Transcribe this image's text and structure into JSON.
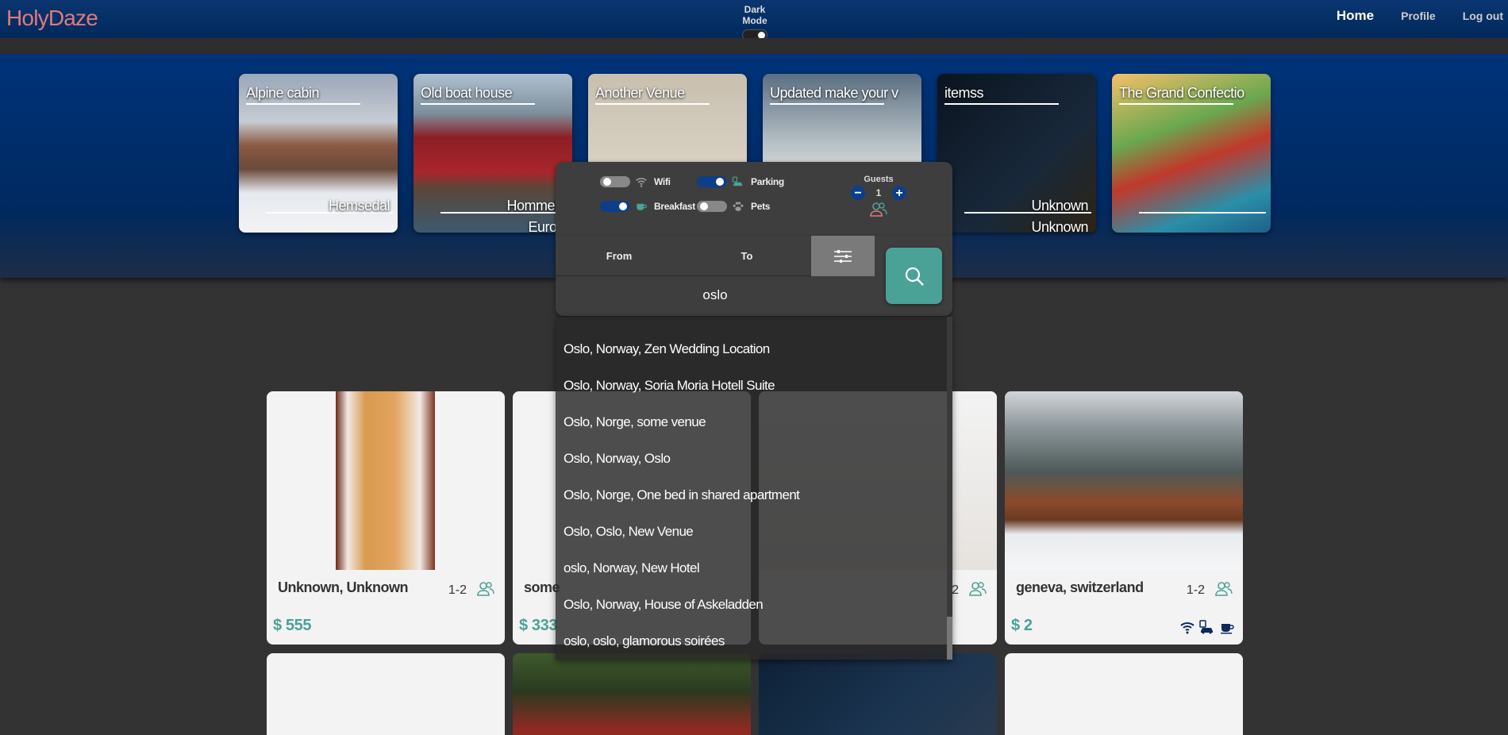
{
  "app": {
    "title": "HolyDaze"
  },
  "nav": {
    "dark_mode_label": "Dark Mode",
    "links": [
      {
        "label": "Home",
        "active": true
      },
      {
        "label": "Profile",
        "active": false
      },
      {
        "label": "Log out",
        "active": false
      }
    ]
  },
  "featured": [
    {
      "title": "Alpine cabin",
      "location": "Hemsedal",
      "country": ""
    },
    {
      "title": "Old boat house",
      "location": "Hommelv",
      "country": "Europ"
    },
    {
      "title": "Another Venue",
      "location": "",
      "country": ""
    },
    {
      "title": "Updated make your v",
      "location": "",
      "country": ""
    },
    {
      "title": "itemss",
      "location": "Unknown",
      "country": "Unknown"
    },
    {
      "title": "The Grand Confectio",
      "location": "",
      "country": ""
    }
  ],
  "filters": {
    "wifi": {
      "label": "Wifi",
      "on": false
    },
    "parking": {
      "label": "Parking",
      "on": true
    },
    "breakfast": {
      "label": "Breakfast",
      "on": true
    },
    "pets": {
      "label": "Pets",
      "on": false
    }
  },
  "guests": {
    "label": "Guests",
    "value": "1",
    "minus": "−",
    "plus": "+"
  },
  "search": {
    "from_label": "From",
    "to_label": "To",
    "query": "oslo"
  },
  "suggestions": [
    "Oslo, Norway, Zen Wedding Location",
    "Oslo, Norway, Soria Moria Hotell Suite",
    "Oslo, Norge, some venue",
    "Oslo, Norway, Oslo",
    "Oslo, Norge, One bed in shared apartment",
    "Oslo, Oslo, New Venue",
    "oslo, Norway, New Hotel",
    "Oslo, Norway, House of Askeladden",
    "oslo, oslo, glamorous soirées"
  ],
  "venues": [
    {
      "location": "Unknown, Unknown",
      "capacity": "1-2",
      "price": "$ 555"
    },
    {
      "location": "some",
      "capacity": "",
      "price": "$ 333"
    },
    {
      "location": "",
      "capacity": "2",
      "price": ""
    },
    {
      "location": "geneva, switzerland",
      "capacity": "1-2",
      "price": "$ 2"
    }
  ],
  "colors": {
    "nav": "#0a3570",
    "accent": "#4aa297",
    "logo": "#e07a7a",
    "toggle_on": "#0b3f8a"
  }
}
